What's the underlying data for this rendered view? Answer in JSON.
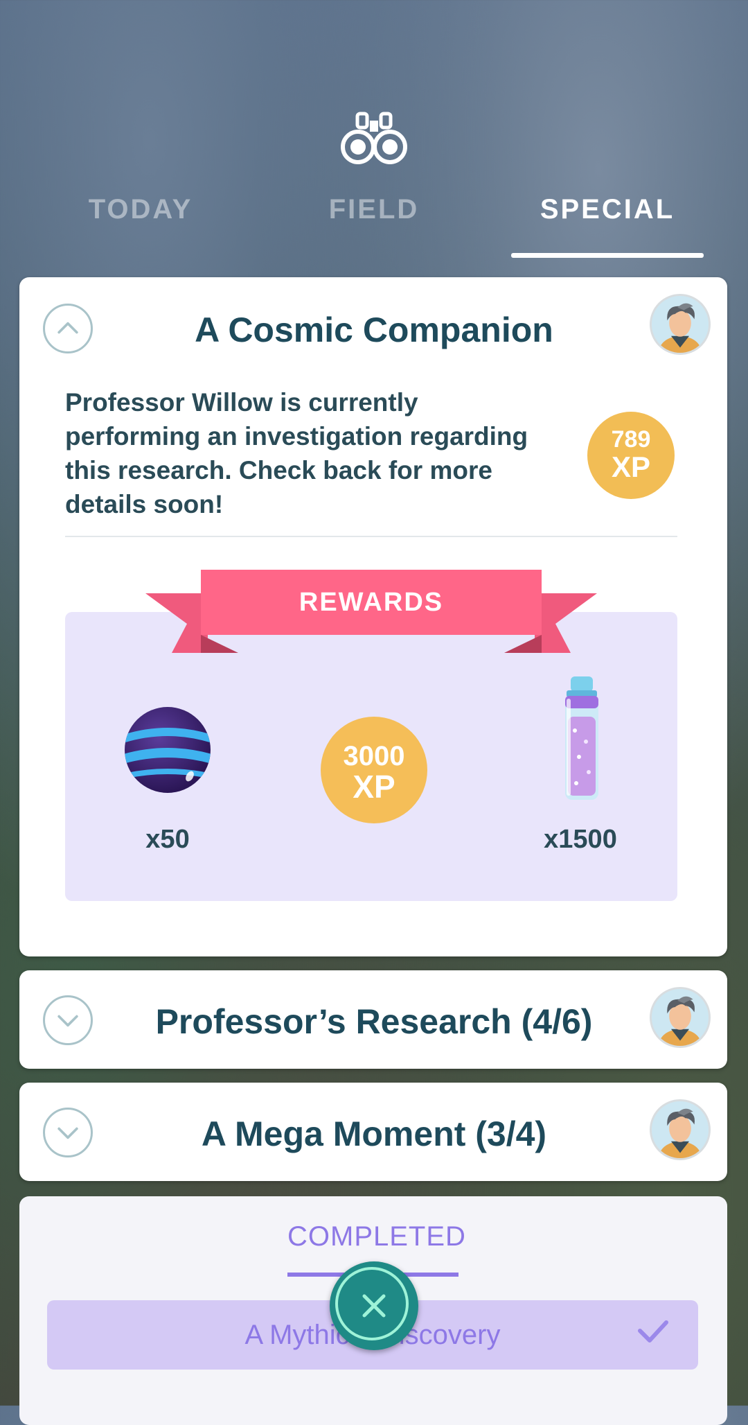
{
  "tabs": [
    {
      "label": "TODAY",
      "active": false
    },
    {
      "label": "FIELD",
      "active": false
    },
    {
      "label": "SPECIAL",
      "active": true
    }
  ],
  "header_icon": "binoculars-icon",
  "research": {
    "title": "A Cosmic Companion",
    "expanded": true,
    "description": "Professor Willow is currently performing an investigation regarding this research. Check back for more details soon!",
    "xp_badge": {
      "value": "789",
      "unit": "XP"
    },
    "rewards_title": "REWARDS",
    "rewards": [
      {
        "item": "ball-icon",
        "label": "x50"
      },
      {
        "item": "xp",
        "value": "3000",
        "unit": "XP"
      },
      {
        "item": "stardust-icon",
        "label": "x1500"
      }
    ]
  },
  "collapsed_research": [
    {
      "title": "Professor’s Research (4/6)"
    },
    {
      "title": "A Mega Moment (3/4)"
    }
  ],
  "completed": {
    "tab_label": "COMPLETED",
    "items": [
      {
        "title": "A Mythical Discovery",
        "done": true
      }
    ]
  },
  "colors": {
    "title": "#1e4a5b",
    "xp_gold": "#f2bd55",
    "ribbon": "#ff6688",
    "rewards_bg": "#e9e5fb",
    "completed_purple": "#8d78e6",
    "close_button": "#1f8a86"
  }
}
